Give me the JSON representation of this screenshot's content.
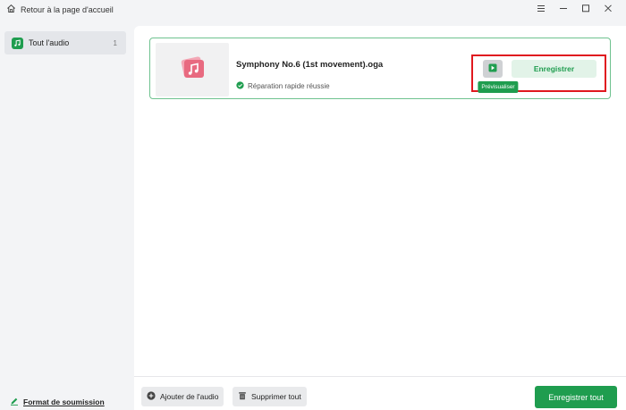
{
  "titlebar": {
    "back_label": "Retour à la page d'accueil",
    "icons": [
      "home-icon",
      "menu-icon",
      "minimize-icon",
      "maximize-icon",
      "close-icon"
    ]
  },
  "sidebar": {
    "items": [
      {
        "label": "Tout l'audio",
        "count": "1",
        "icon": "music-note-icon"
      }
    ],
    "format_link": "Format de soumission"
  },
  "file_list": [
    {
      "name": "Symphony No.6 (1st movement).oga",
      "status": "Réparation rapide réussie",
      "status_icon": "check-circle-icon",
      "preview_tooltip": "Prévisualiser",
      "save_label": "Enregistrer"
    }
  ],
  "bottombar": {
    "add_label": "Ajouter de l'audio",
    "delete_label": "Supprimer tout",
    "save_all_label": "Enregistrer tout"
  },
  "colors": {
    "accent": "#1f9d4f",
    "accent_light": "#e2f3e8",
    "highlight": "#e0191f",
    "thumb_pink": "#e86a80"
  }
}
